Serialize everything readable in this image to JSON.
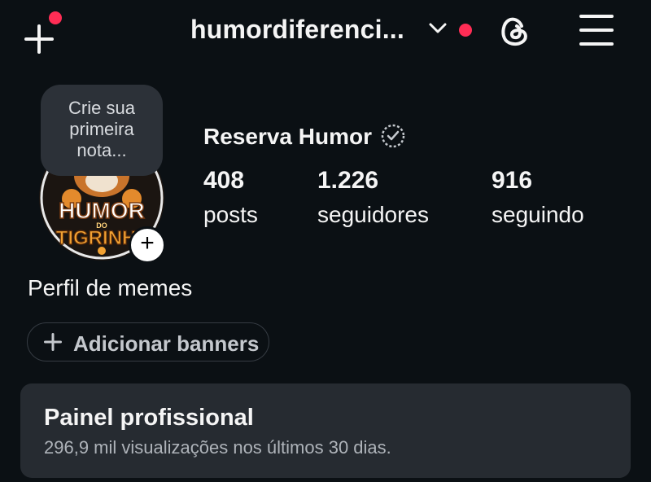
{
  "header": {
    "username": "humordiferenci...",
    "create_icon": "plus-icon",
    "switch_account_icon": "chevron-down-icon",
    "threads_icon": "threads-icon",
    "menu_icon": "hamburger-menu-icon",
    "notification_color": "#ff2d55"
  },
  "profile": {
    "note_text": "Crie sua primeira nota...",
    "display_name": "Reserva Humor",
    "verified_icon": "verified-badge-icon",
    "avatar_text_top": "HUMOR",
    "avatar_text_mid": "DO",
    "avatar_text_bottom": "TIGRINH",
    "stats": [
      {
        "value": "408",
        "label": "posts"
      },
      {
        "value": "1.226",
        "label": "seguidores"
      },
      {
        "value": "916",
        "label": "seguindo"
      }
    ],
    "bio": "Perfil de memes",
    "add_banners_label": "Adicionar banners"
  },
  "dashboard": {
    "title": "Painel profissional",
    "subtitle": "296,9 mil visualizações nos últimos 30 dias."
  },
  "colors": {
    "background": "#0b1014",
    "card": "#262b31",
    "accent_red": "#ff2d55"
  }
}
